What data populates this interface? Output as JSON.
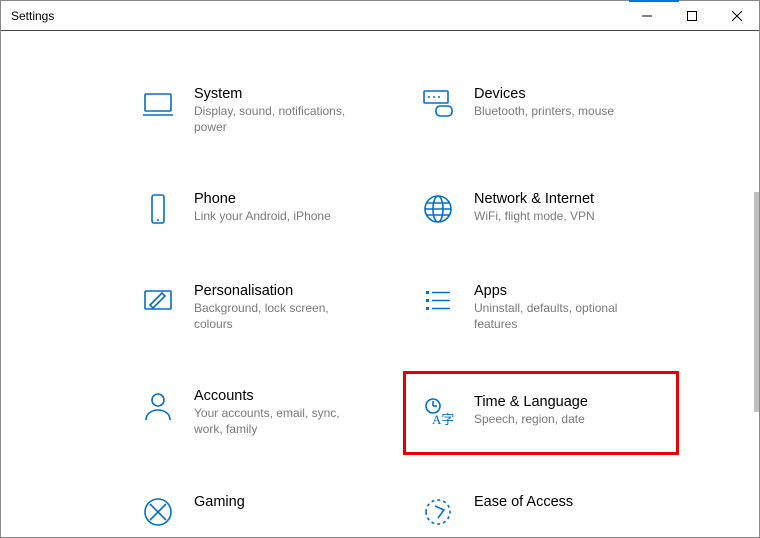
{
  "window": {
    "title": "Settings"
  },
  "tiles": {
    "system": {
      "title": "System",
      "sub": "Display, sound, notifications, power"
    },
    "devices": {
      "title": "Devices",
      "sub": "Bluetooth, printers, mouse"
    },
    "phone": {
      "title": "Phone",
      "sub": "Link your Android, iPhone"
    },
    "network": {
      "title": "Network & Internet",
      "sub": "WiFi, flight mode, VPN"
    },
    "personalisation": {
      "title": "Personalisation",
      "sub": "Background, lock screen, colours"
    },
    "apps": {
      "title": "Apps",
      "sub": "Uninstall, defaults, optional features"
    },
    "accounts": {
      "title": "Accounts",
      "sub": "Your accounts, email, sync, work, family"
    },
    "time": {
      "title": "Time & Language",
      "sub": "Speech, region, date"
    },
    "gaming": {
      "title": "Gaming",
      "sub": ""
    },
    "ease": {
      "title": "Ease of Access",
      "sub": ""
    }
  },
  "highlighted_tile": "time",
  "colors": {
    "accent": "#0070c9",
    "highlight": "#e60000"
  }
}
